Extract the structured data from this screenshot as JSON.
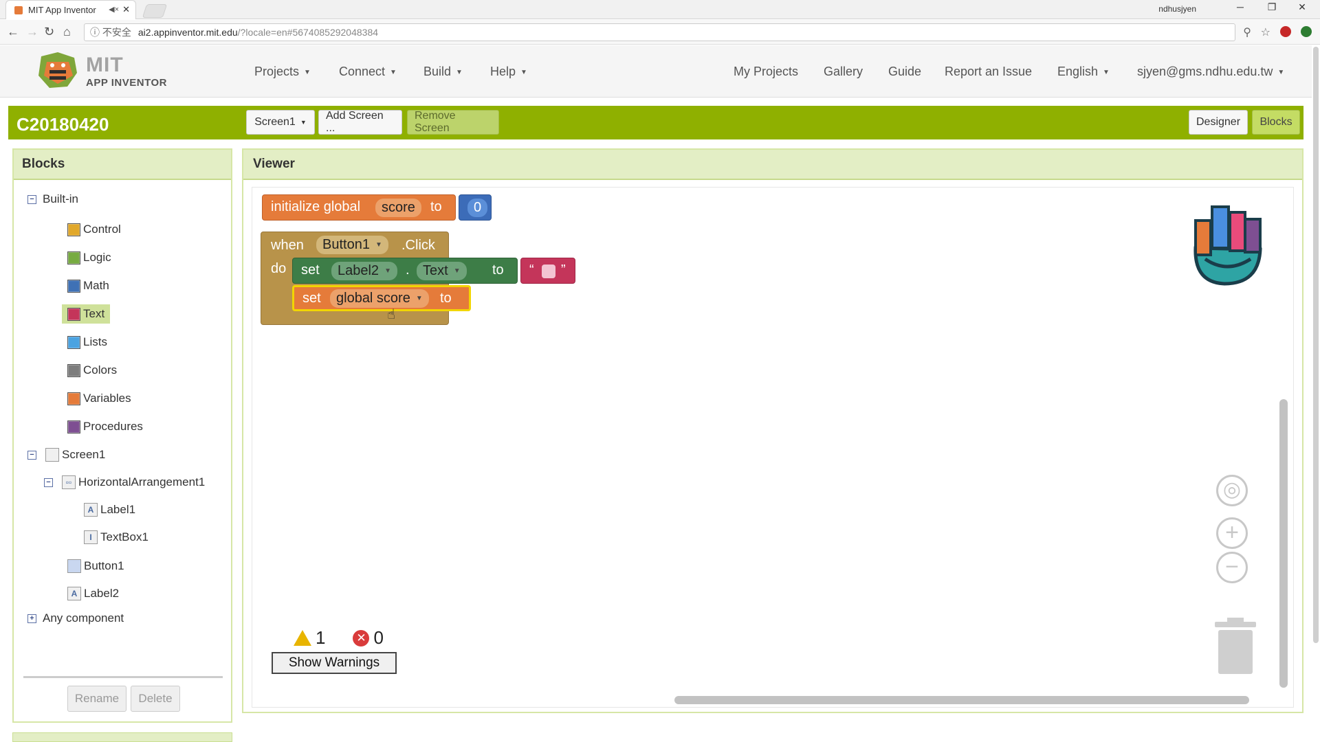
{
  "browser": {
    "tab_title": "MIT App Inventor",
    "tab_mute": "◀×",
    "tab_close": "✕",
    "profile_name": "ndhusjyen",
    "win_min": "─",
    "win_restore": "❐",
    "win_close": "✕",
    "nav_back": "←",
    "nav_forward": "→",
    "nav_reload": "↻",
    "nav_home": "⌂",
    "url_security": "ⓘ 不安全",
    "url_host": "ai2.appinventor.mit.edu",
    "url_path": "/?locale=en#5674085292048384",
    "zoom_icon": "⚲",
    "bookmark_icon": "☆"
  },
  "header": {
    "logo_mit": "MIT",
    "logo_app_inventor": "APP INVENTOR",
    "menu": [
      "Projects",
      "Connect",
      "Build",
      "Help"
    ],
    "right_links": [
      "My Projects",
      "Gallery",
      "Guide",
      "Report an Issue"
    ],
    "language": "English",
    "user": "sjyen@gms.ndhu.edu.tw",
    "caret": "▼"
  },
  "project_bar": {
    "project_name": "C20180420",
    "screen_select": "Screen1",
    "add_screen": "Add Screen ...",
    "remove_screen": "Remove Screen",
    "designer": "Designer",
    "blocks": "Blocks"
  },
  "blocks_panel": {
    "title": "Blocks",
    "builtin_label": "Built-in",
    "builtin": [
      {
        "label": "Control",
        "color": "#e1a82b"
      },
      {
        "label": "Logic",
        "color": "#77ab41"
      },
      {
        "label": "Math",
        "color": "#3f71b5"
      },
      {
        "label": "Text",
        "color": "#c4355a"
      },
      {
        "label": "Lists",
        "color": "#4ba3e1"
      },
      {
        "label": "Colors",
        "color": "#7d7d7d"
      },
      {
        "label": "Variables",
        "color": "#e57b3a"
      },
      {
        "label": "Procedures",
        "color": "#7e4f92"
      }
    ],
    "selected": "Text",
    "screen": "Screen1",
    "components": {
      "arrangement": "HorizontalArrangement1",
      "label1": "Label1",
      "textbox1": "TextBox1",
      "button1": "Button1",
      "label2": "Label2"
    },
    "any_component": "Any component",
    "toggle_minus": "−",
    "toggle_plus": "+",
    "rename": "Rename",
    "delete": "Delete"
  },
  "viewer": {
    "title": "Viewer",
    "init_block": {
      "label": "initialize global",
      "var": "score",
      "to": "to",
      "value": "0"
    },
    "event_block": {
      "when": "when",
      "component": "Button1",
      "event": ".Click",
      "do": "do"
    },
    "set_label": {
      "set": "set",
      "component": "Label2",
      "dot": ".",
      "prop": "Text",
      "to": "to",
      "open_quote": "“",
      "close_quote": "”"
    },
    "set_global": {
      "set": "set",
      "var": "global score",
      "to": "to"
    },
    "warnings_count": "1",
    "errors_count": "0",
    "error_icon": "✕",
    "show_warnings": "Show Warnings",
    "target_icon": "◎",
    "zoom_in": "+",
    "zoom_out": "−",
    "cursor_icon": "☝"
  }
}
